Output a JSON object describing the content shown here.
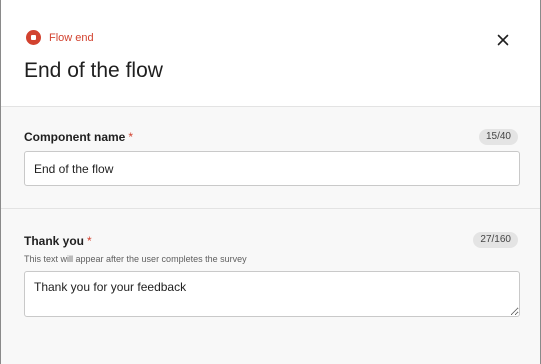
{
  "header": {
    "type_label": "Flow end",
    "title": "End of the flow",
    "icons": {
      "type": "stop-circle-icon",
      "close": "close-icon"
    },
    "accent_color": "#d2422f"
  },
  "component_name": {
    "label": "Component name",
    "required_mark": "*",
    "counter": "15/40",
    "value": "End of the flow"
  },
  "thank_you": {
    "label": "Thank you",
    "required_mark": "*",
    "counter": "27/160",
    "help": "This text will appear after the user completes the survey",
    "value": "Thank you for your feedback"
  }
}
